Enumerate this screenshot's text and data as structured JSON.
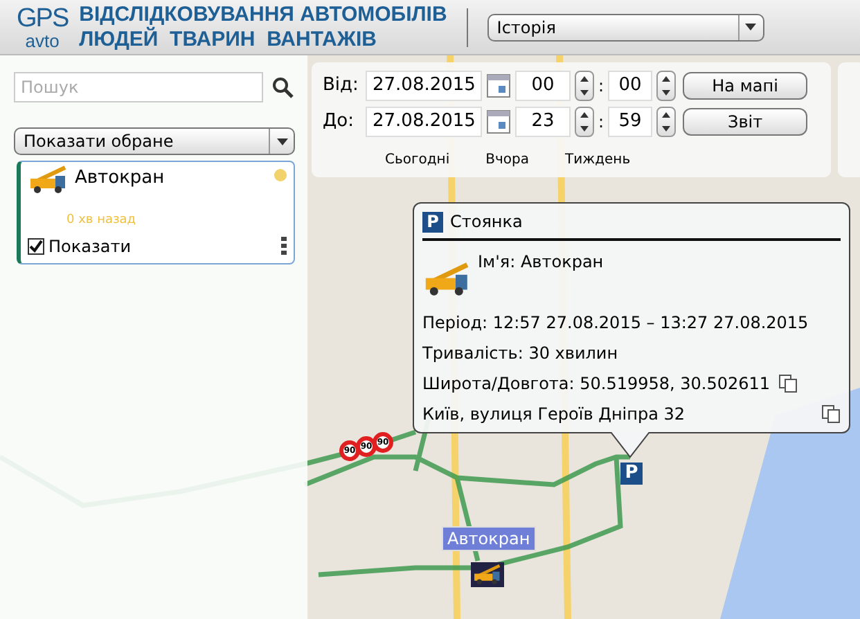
{
  "header": {
    "logo_top": "GPS",
    "logo_bottom": "avto",
    "title_line1": "ВІДСЛІДКОВУВАННЯ АВТОМОБІЛІВ",
    "title_line2": "ЛЮДЕЙ  ТВАРИН  ВАНТАЖІВ",
    "mode_select": "Історія"
  },
  "sidebar": {
    "search": {
      "placeholder": "Пошук"
    },
    "filter_select": "Показати обране",
    "vehicles": [
      {
        "name": "Автокран",
        "color": "#f2d36b",
        "last_seen": "0 хв назад",
        "show_label": "Показати",
        "checked": true,
        "selected": true
      }
    ]
  },
  "period": {
    "from_label": "Від:",
    "from_date": "27.08.2015",
    "from_hour": "00",
    "from_minute": "00",
    "to_label": "До:",
    "to_date": "27.08.2015",
    "to_hour": "23",
    "to_minute": "59",
    "separator": ":",
    "map_button": "На мапі",
    "report_button": "Звіт",
    "quick_ranges": [
      "Сьогодні",
      "Вчора",
      "Тиждень"
    ]
  },
  "popup": {
    "title": "Стоянка",
    "parking_glyph": "P",
    "name": "Ім'я: Автокран",
    "period": "Період: 12:57 27.08.2015 – 13:27 27.08.2015",
    "duration": "Тривалість: 30 хвилин",
    "coordinates": "Широта/Довгота: 50.519958, 30.502611",
    "address": "Київ, вулиця Героїв Дніпра 32"
  },
  "map": {
    "vehicle_label": "Автокран",
    "parking_glyph": "P",
    "speed_markers": [
      "90",
      "90",
      "90"
    ]
  }
}
